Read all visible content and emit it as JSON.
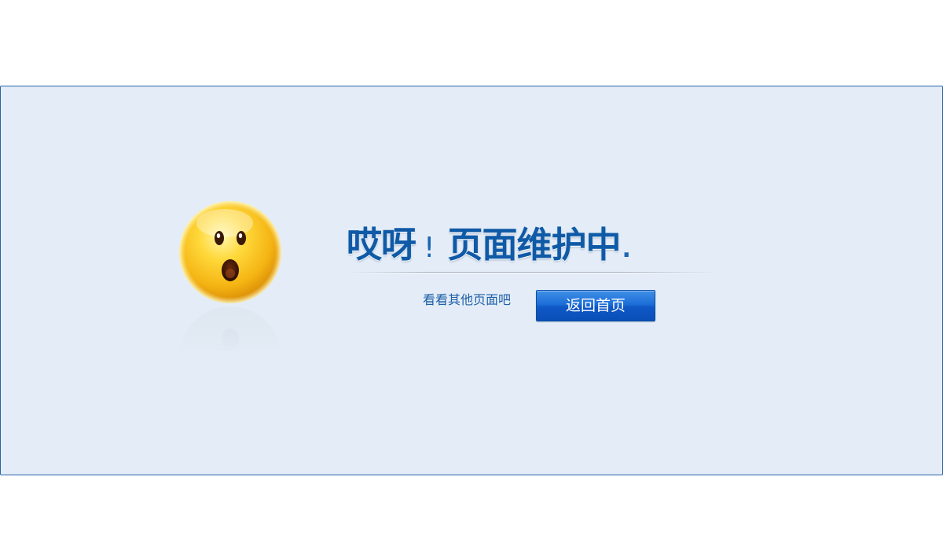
{
  "page": {
    "background_color": "#ffffff",
    "panel_color": "#e4edf7",
    "panel_border_color": "#2a63a8"
  },
  "illustration": {
    "icon": "surprised-face-icon",
    "face_color": "#f7c619"
  },
  "headline": {
    "part1": "哎呀",
    "exclamation": "!",
    "part2": "页面维护中",
    "trailing": ".",
    "color": "#0f5aa7"
  },
  "actions": {
    "other_pages_link": "看看其他页面吧",
    "home_button": "返回首页",
    "button_color": "#1d6ed8"
  }
}
